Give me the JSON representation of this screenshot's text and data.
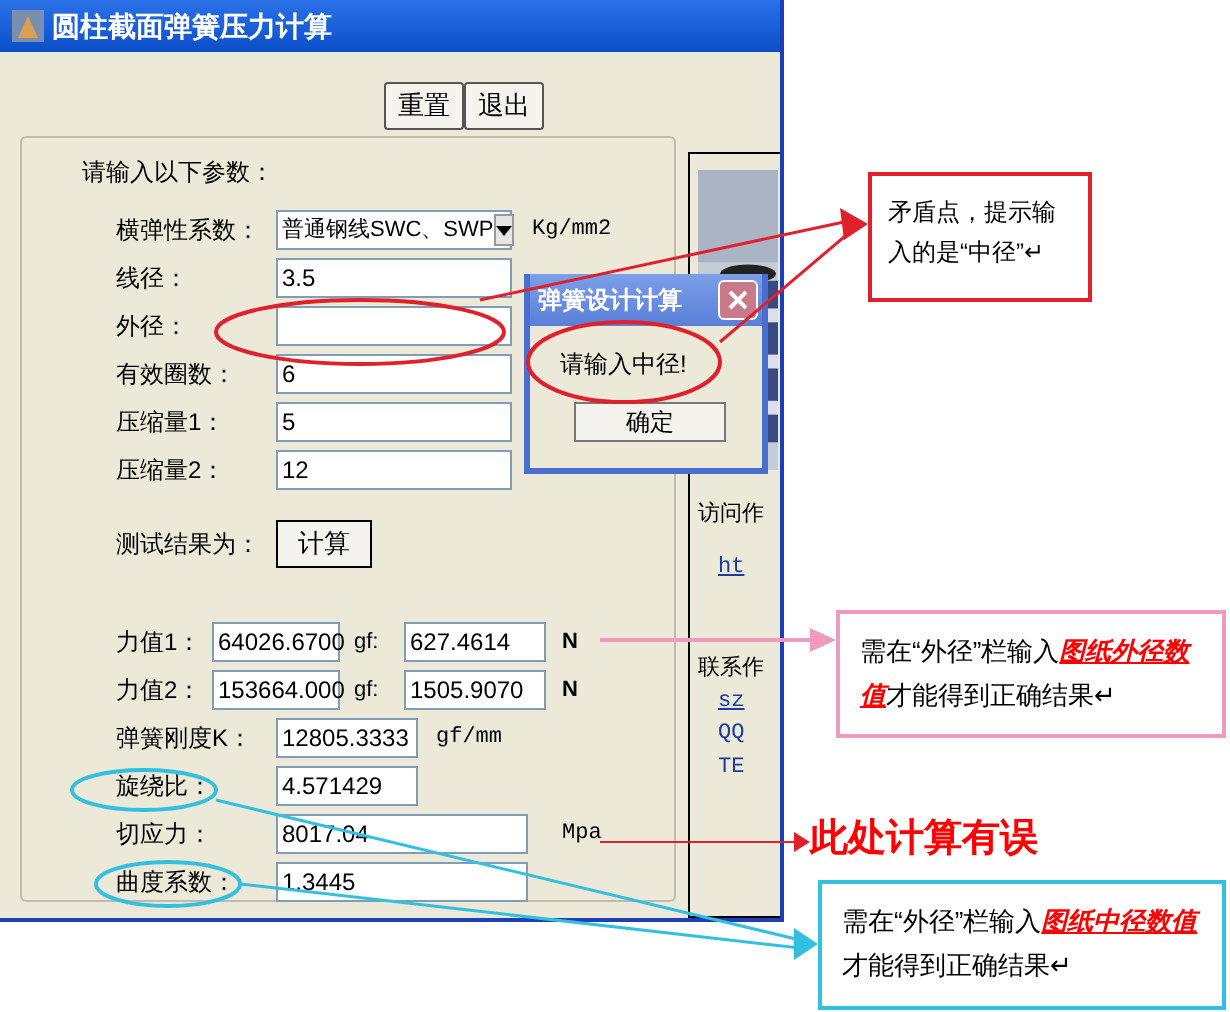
{
  "window": {
    "title": "圆柱截面弹簧压力计算"
  },
  "toolbar_buttons": [
    "重置",
    "退出"
  ],
  "input_group": {
    "prompt": "请输入以下参数：",
    "params": [
      {
        "kind": "dropdown",
        "label": "横弹性系数：",
        "value": "普通钢线SWC、SWP",
        "unit": "Kg/mm2"
      },
      {
        "kind": "text",
        "label": "线径：",
        "value": "3.5"
      },
      {
        "kind": "text",
        "label": "外径："
      },
      {
        "kind": "text",
        "label": "有效圈数：",
        "value": "6"
      },
      {
        "kind": "text",
        "label": "压缩量1：",
        "value": "5"
      },
      {
        "kind": "text",
        "label": "压缩量2：",
        "value": "12"
      }
    ],
    "result_label": "测试结果为：",
    "calc_button": "计算",
    "forces": [
      {
        "label": "力值1：",
        "gf": "64026.6700",
        "gf_unit": "gf:",
        "n": "627.4614",
        "n_unit": "N"
      },
      {
        "label": "力值2：",
        "gf": "153664.000",
        "gf_unit": "gf:",
        "n": "1505.9070",
        "n_unit": "N"
      }
    ],
    "results": [
      {
        "label": "弹簧刚度K：",
        "value": "12805.3333",
        "unit": "gf/mm",
        "wide": false
      },
      {
        "label": "旋绕比：",
        "value": "4.571429",
        "wide": false
      },
      {
        "label": "切应力：",
        "value": "8017.04",
        "unit": "Mpa",
        "wide": true
      },
      {
        "label": "曲度系数：",
        "value": "1.3445",
        "wide": true
      }
    ]
  },
  "side_panel": {
    "texts": [
      {
        "text": "访问作",
        "kind": "label"
      },
      {
        "text": "ht",
        "kind": "link"
      },
      {
        "text": "联系作",
        "kind": "label"
      },
      {
        "text": "sz",
        "kind": "link"
      },
      {
        "text": "QQ",
        "kind": "info"
      },
      {
        "text": "TE",
        "kind": "info"
      }
    ]
  },
  "dialog": {
    "title": "弹簧设计计算",
    "message": "请输入中径!",
    "button": "确定"
  },
  "annotations": [
    {
      "kind": "box",
      "color": "#e0202a",
      "parts": [
        {
          "text": "矛盾点，提示输入的是“中径”↵",
          "emphasis": false
        }
      ]
    },
    {
      "kind": "box",
      "color": "#f09ac0",
      "parts": [
        {
          "text": "需在“外径”栏输入",
          "emphasis": false
        },
        {
          "text": "图纸外径数值",
          "emphasis": true
        },
        {
          "text": "才能得到正确结果↵",
          "emphasis": false
        }
      ]
    },
    {
      "kind": "label",
      "color": "#ff0000",
      "parts": [
        {
          "text": "此处计算有误",
          "emphasis": false
        }
      ]
    },
    {
      "kind": "box",
      "color": "#33c0e0",
      "parts": [
        {
          "text": "需在“外径”栏输入",
          "emphasis": false
        },
        {
          "text": "图纸中径数值",
          "emphasis": true
        },
        {
          "text": "才能得到正确结果↵",
          "emphasis": false
        }
      ]
    }
  ]
}
